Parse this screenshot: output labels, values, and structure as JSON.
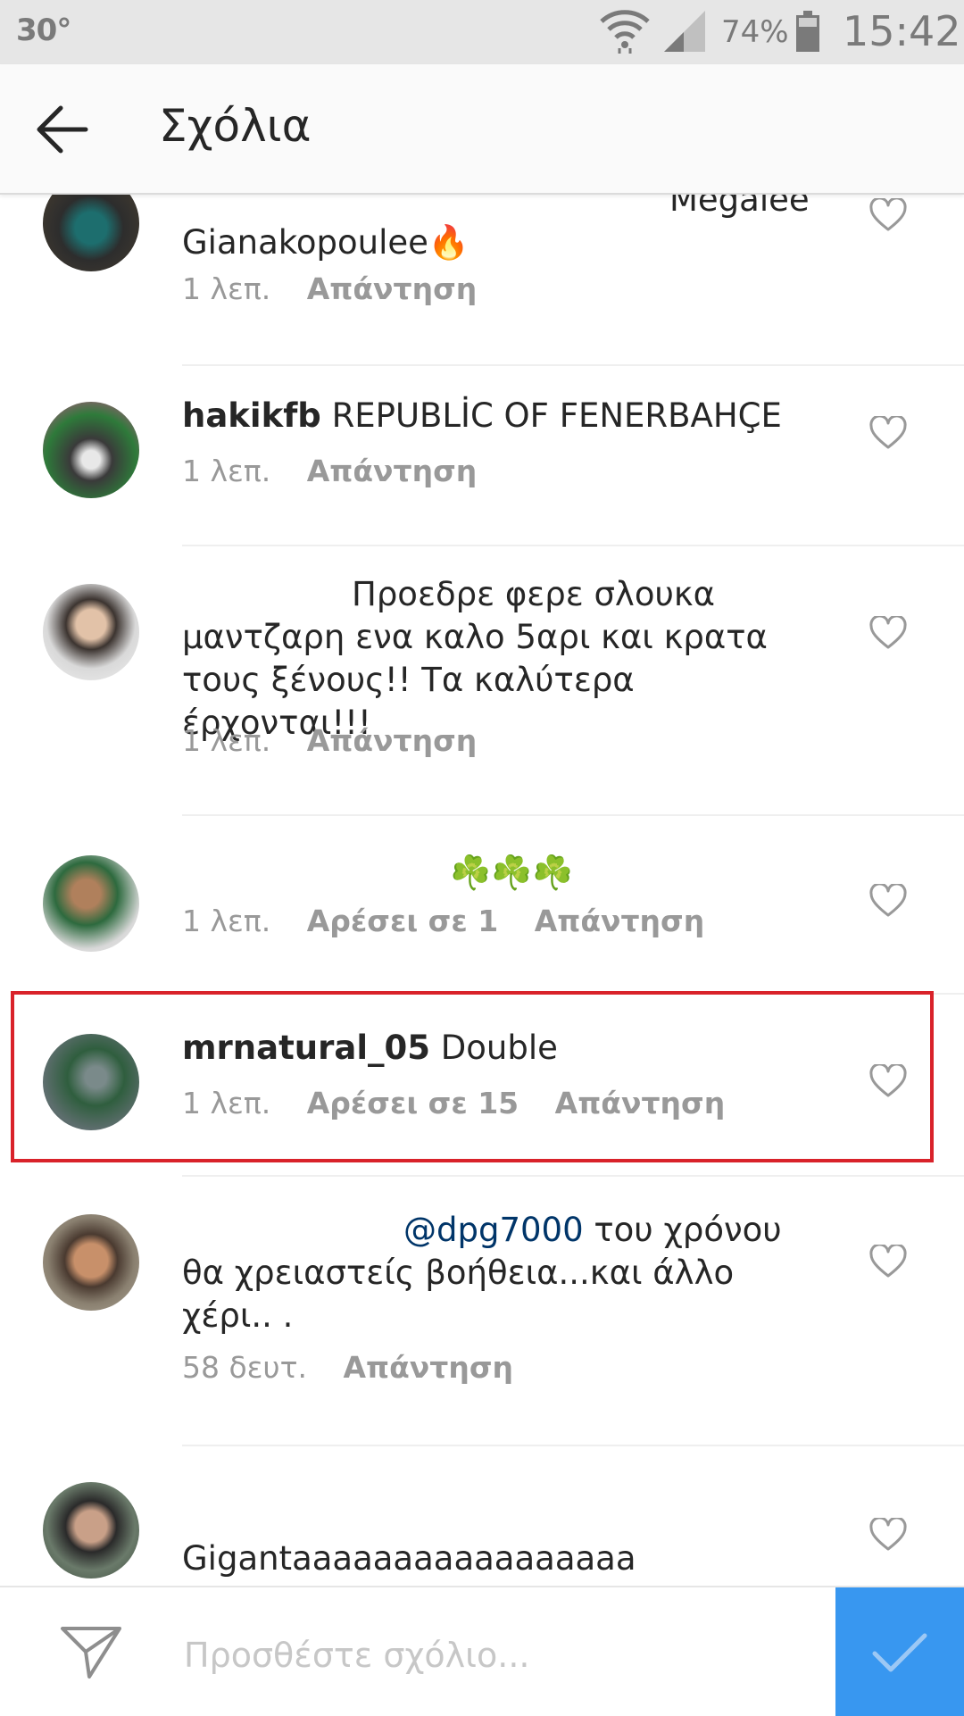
{
  "status_bar": {
    "temperature": "30°",
    "battery": "74%",
    "time": "15:42"
  },
  "header": {
    "title": "Σχόλια"
  },
  "comments": [
    {
      "username": "",
      "text_line1": "Megalee",
      "text_line2": "Gianakopoulee🔥",
      "time": "1 λεπ.",
      "likes": "",
      "reply": "Απάντηση"
    },
    {
      "username": "hakikfb",
      "text": "REPUBLİC OF FENERBAHÇE",
      "time": "1 λεπ.",
      "likes": "",
      "reply": "Απάντηση"
    },
    {
      "username": "",
      "text_line1": "Προεδρε φερε σλουκα",
      "text_line2": "μαντζαρη ενα καλο 5αρι και κρατα",
      "text_line3": "τους ξένους!! Τα καλύτερα έρχονται!!!",
      "time": "1 λεπ.",
      "likes": "",
      "reply": "Απάντηση"
    },
    {
      "username": "",
      "text": "☘️☘️☘️",
      "time": "1 λεπ.",
      "likes": "Αρέσει σε 1",
      "reply": "Απάντηση"
    },
    {
      "username": "mrnatural_05",
      "text": "Double",
      "time": "1 λεπ.",
      "likes": "Αρέσει σε 15",
      "reply": "Απάντηση"
    },
    {
      "username": "",
      "mention": "@dpg7000",
      "text_line1": "του χρόνου",
      "text_line2": "θα χρειαστείς βοήθεια...και άλλο",
      "text_line3": "χέρι.. .",
      "time": "58 δευτ.",
      "likes": "",
      "reply": "Απάντηση"
    },
    {
      "username": "",
      "text": "Gigantaaaaaaaaaaaaaaaaa",
      "time": "",
      "likes": "",
      "reply": ""
    }
  ],
  "composer": {
    "placeholder": "Προσθέστε σχόλιο..."
  },
  "icons": {
    "back": "arrow-left-icon",
    "heart": "heart-outline-icon",
    "send": "send-icon",
    "post": "checkmark-icon"
  },
  "colors": {
    "accent": "#3897f0",
    "highlight": "#d9222a",
    "mention": "#003569"
  }
}
